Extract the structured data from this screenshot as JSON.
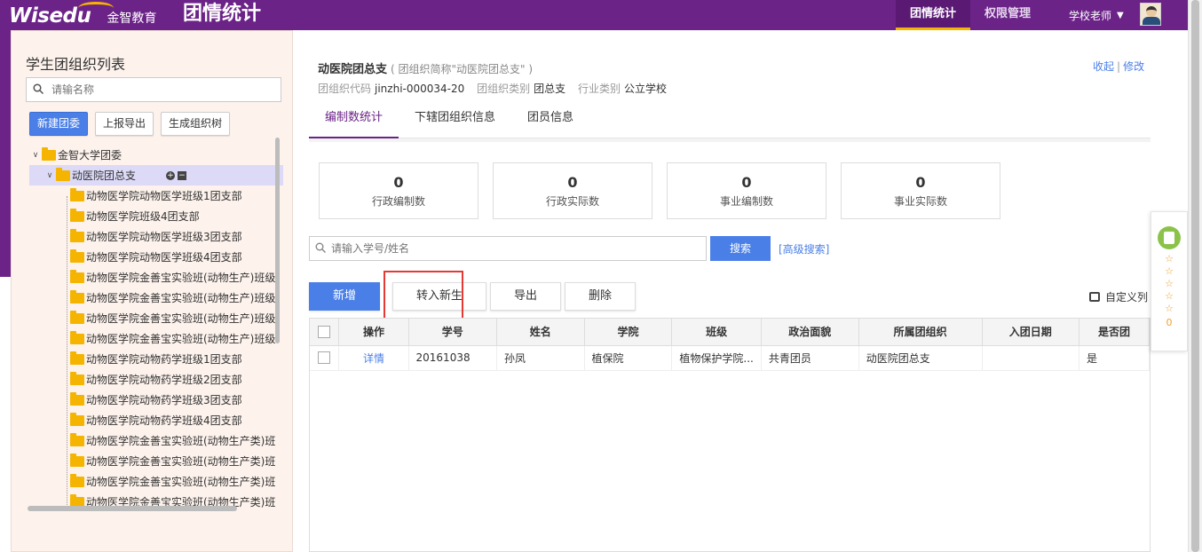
{
  "header": {
    "brand": "Wisedu",
    "brand_cn": "金智教育",
    "app_title": "团情统计",
    "nav": [
      {
        "label": "团情统计",
        "active": true
      },
      {
        "label": "权限管理",
        "active": false
      }
    ],
    "user": "学校老师"
  },
  "sidebar": {
    "title": "学生团组织列表",
    "search_placeholder": "请输名称",
    "buttons": [
      "新建团委",
      "上报导出",
      "生成组织树"
    ],
    "root": "金智大学团委",
    "selected": "动医院团总支",
    "children": [
      "动物医学院动物医学班级1团支部",
      "动物医学院班级4团支部",
      "动物医学院动物医学班级3团支部",
      "动物医学院动物医学班级4团支部",
      "动物医学院金善宝实验班(动物生产)班级",
      "动物医学院金善宝实验班(动物生产)班级",
      "动物医学院金善宝实验班(动物生产)班级",
      "动物医学院金善宝实验班(动物生产)班级",
      "动物医学院动物药学班级1团支部",
      "动物医学院动物药学班级2团支部",
      "动物医学院动物药学班级3团支部",
      "动物医学院动物药学班级4团支部",
      "动物医学院金善宝实验班(动物生产类)班",
      "动物医学院金善宝实验班(动物生产类)班",
      "动物医学院金善宝实验班(动物生产类)班",
      "动物医学院金善宝实验班(动物生产类)班"
    ]
  },
  "org": {
    "name": "动医院团总支",
    "short": "( 团组织简称\"动医院团总支\" )",
    "code_label": "团组织代码",
    "code": "jinzhi-000034-20",
    "type_label": "团组织类别",
    "type": "团总支",
    "industry_label": "行业类别",
    "industry": "公立学校",
    "collapse": "收起",
    "edit": "修改"
  },
  "tabs": [
    "编制数统计",
    "下辖团组织信息",
    "团员信息"
  ],
  "stats": [
    {
      "value": "0",
      "label": "行政编制数"
    },
    {
      "value": "0",
      "label": "行政实际数"
    },
    {
      "value": "0",
      "label": "事业编制数"
    },
    {
      "value": "0",
      "label": "事业实际数"
    }
  ],
  "member_search": {
    "placeholder": "请输入学号/姓名",
    "button": "搜索",
    "advanced": "[高级搜索]"
  },
  "actions": [
    "新增",
    "转入新生",
    "导出",
    "删除"
  ],
  "custom_columns": "自定义列",
  "table": {
    "headers": [
      "操作",
      "学号",
      "姓名",
      "学院",
      "班级",
      "政治面貌",
      "所属团组织",
      "入团日期",
      "是否团"
    ],
    "rows": [
      [
        "详情",
        "20161038",
        "孙凤",
        "植保院",
        "植物保护学院...",
        "共青团员",
        "动医院团总支",
        "",
        "是"
      ]
    ]
  },
  "widget": {
    "count": "0"
  },
  "colors": {
    "brand_purple": "#6b2387",
    "accent_blue": "#4a7fe7",
    "highlight_red": "#e53935"
  }
}
